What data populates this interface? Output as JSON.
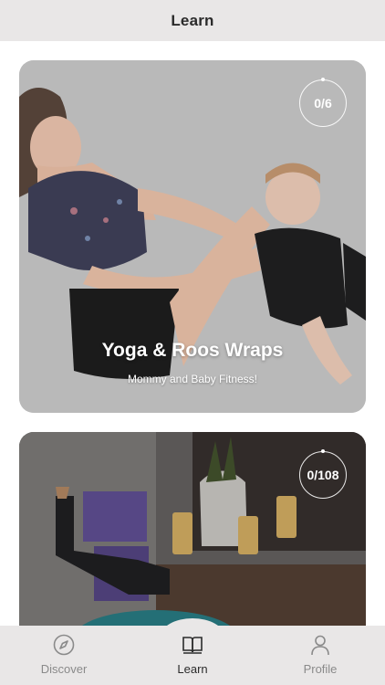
{
  "header": {
    "title": "Learn"
  },
  "cards": [
    {
      "title": "Yoga & Roos Wraps",
      "subtitle": "Mommy and Baby Fitness!",
      "progress": "0/6"
    },
    {
      "title": "",
      "subtitle": "",
      "progress": "0/108"
    }
  ],
  "tabbar": {
    "items": [
      {
        "label": "Discover",
        "icon": "compass-icon",
        "active": false
      },
      {
        "label": "Learn",
        "icon": "book-icon",
        "active": true
      },
      {
        "label": "Profile",
        "icon": "person-icon",
        "active": false
      }
    ]
  },
  "colors": {
    "header_bg": "#e9e7e7",
    "active_tab": "#2b2b2b",
    "inactive_tab": "#8a8a8a"
  }
}
